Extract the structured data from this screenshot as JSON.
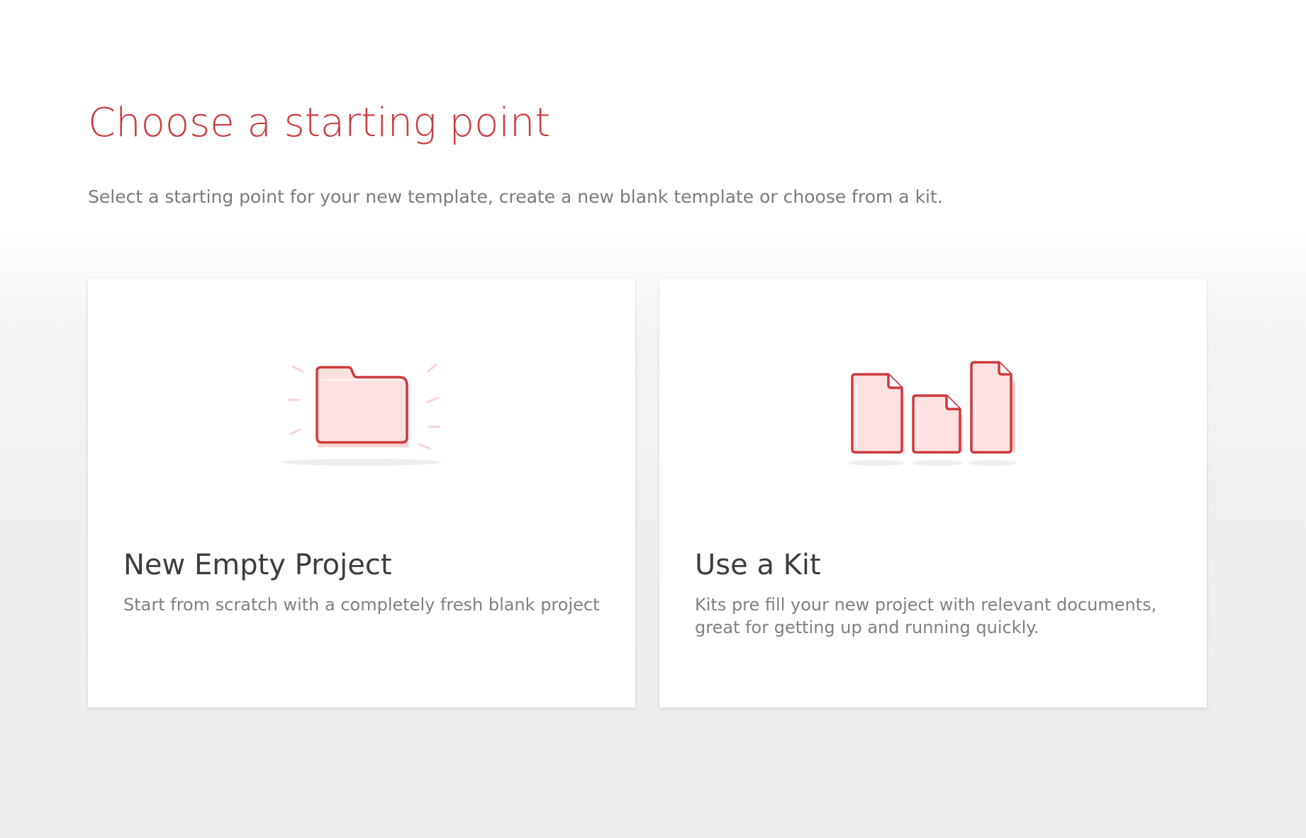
{
  "page": {
    "title": "Choose a starting point",
    "subtitle": "Select a starting point for your new template, create a new blank template or choose from a kit."
  },
  "options": [
    {
      "title": "New Empty Project",
      "description": "Start from scratch with a completely fresh blank project",
      "icon": "folder-icon"
    },
    {
      "title": "Use a Kit",
      "description": "Kits pre fill your new project with relevant documents, great for getting up and running quickly.",
      "icon": "documents-icon"
    }
  ],
  "colors": {
    "accent": "#cd3b3e",
    "icon_fill": "#fde1e0",
    "icon_glow": "#f9d4d2",
    "title_text": "#3d3d3d",
    "body_text": "#7b7b7b"
  }
}
